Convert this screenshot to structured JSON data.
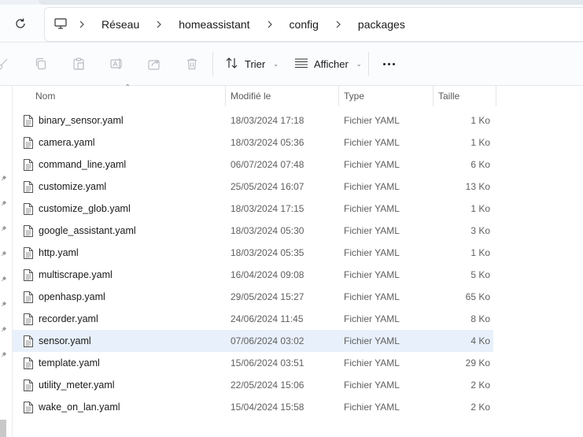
{
  "address_bar": {
    "breadcrumbs": [
      "Réseau",
      "homeassistant",
      "config",
      "packages"
    ]
  },
  "toolbar": {
    "sort_label": "Trier",
    "view_label": "Afficher"
  },
  "columns": {
    "name": "Nom",
    "modified": "Modifié le",
    "type": "Type",
    "size": "Taille"
  },
  "files": [
    {
      "name": "binary_sensor.yaml",
      "modified": "18/03/2024 17:18",
      "type": "Fichier YAML",
      "size": "1 Ko"
    },
    {
      "name": "camera.yaml",
      "modified": "18/03/2024 05:36",
      "type": "Fichier YAML",
      "size": "1 Ko"
    },
    {
      "name": "command_line.yaml",
      "modified": "06/07/2024 07:48",
      "type": "Fichier YAML",
      "size": "6 Ko"
    },
    {
      "name": "customize.yaml",
      "modified": "25/05/2024 16:07",
      "type": "Fichier YAML",
      "size": "13 Ko"
    },
    {
      "name": "customize_glob.yaml",
      "modified": "18/03/2024 17:15",
      "type": "Fichier YAML",
      "size": "1 Ko"
    },
    {
      "name": "google_assistant.yaml",
      "modified": "18/03/2024 05:30",
      "type": "Fichier YAML",
      "size": "3 Ko"
    },
    {
      "name": "http.yaml",
      "modified": "18/03/2024 05:35",
      "type": "Fichier YAML",
      "size": "1 Ko"
    },
    {
      "name": "multiscrape.yaml",
      "modified": "16/04/2024 09:08",
      "type": "Fichier YAML",
      "size": "5 Ko"
    },
    {
      "name": "openhasp.yaml",
      "modified": "29/05/2024 15:27",
      "type": "Fichier YAML",
      "size": "65 Ko"
    },
    {
      "name": "recorder.yaml",
      "modified": "24/06/2024 11:45",
      "type": "Fichier YAML",
      "size": "8 Ko"
    },
    {
      "name": "sensor.yaml",
      "modified": "07/06/2024 03:02",
      "type": "Fichier YAML",
      "size": "4 Ko",
      "selected": true
    },
    {
      "name": "template.yaml",
      "modified": "15/06/2024 03:51",
      "type": "Fichier YAML",
      "size": "29 Ko"
    },
    {
      "name": "utility_meter.yaml",
      "modified": "22/05/2024 15:06",
      "type": "Fichier YAML",
      "size": "2 Ko"
    },
    {
      "name": "wake_on_lan.yaml",
      "modified": "15/04/2024 15:58",
      "type": "Fichier YAML",
      "size": "2 Ko"
    }
  ],
  "colors": {
    "selected_row": "#e8f1fb",
    "disabled_icon": "#b9bdc3"
  },
  "icons": {
    "refresh": "refresh-icon",
    "computer": "computer-icon",
    "cut": "cut-icon",
    "copy": "copy-icon",
    "paste": "paste-icon",
    "rename": "rename-icon",
    "share": "share-icon",
    "delete": "delete-icon",
    "sort": "sort-icon",
    "view": "view-icon",
    "more": "more-icon",
    "file": "file-icon",
    "pin": "pin-icon"
  }
}
